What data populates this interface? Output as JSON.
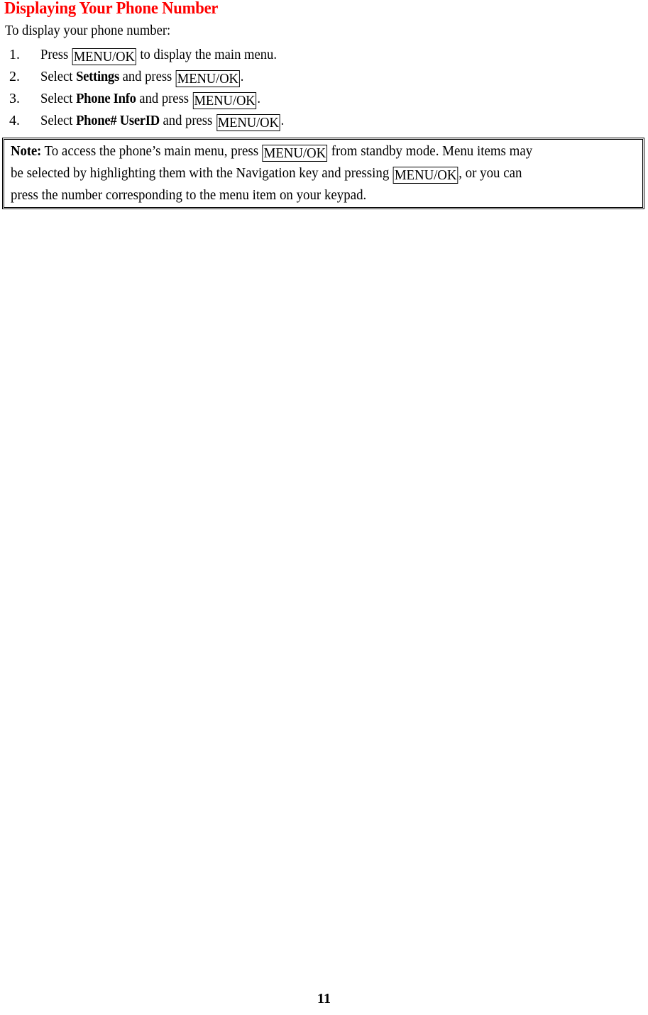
{
  "document": {
    "title": "Displaying Your Phone Number",
    "title_color": "#ff0000",
    "intro": "To display your phone number:",
    "page_number": "11",
    "keycap_label": "MENU/OK"
  },
  "steps": [
    {
      "number": "1.",
      "before": "Press ",
      "keycap": "MENU/OK",
      "after": " to display the main menu."
    },
    {
      "number": "2.",
      "before": "Select ",
      "emphasis": "Settings",
      "middle": " and press ",
      "keycap": "MENU/OK",
      "after": "."
    },
    {
      "number": "3.",
      "before": "Select ",
      "emphasis": "Phone Info",
      "middle": " and press ",
      "keycap": "MENU/OK",
      "after": "."
    },
    {
      "number": "4.",
      "before": "Select ",
      "emphasis": "Phone# UserID",
      "middle": " and press ",
      "keycap": "MENU/OK",
      "after": "."
    }
  ],
  "note": {
    "label": "Note:",
    "line1_before": " To access the phone’s main menu, press ",
    "line1_keycap": "MENU/OK",
    "line1_after": " from standby mode. Menu items may",
    "line2_before": "be selected by highlighting them with the Navigation key and pressing ",
    "line2_keycap": "MENU/OK",
    "line2_after": ", or you can",
    "line3": "press the number corresponding to the menu item on your keypad."
  }
}
